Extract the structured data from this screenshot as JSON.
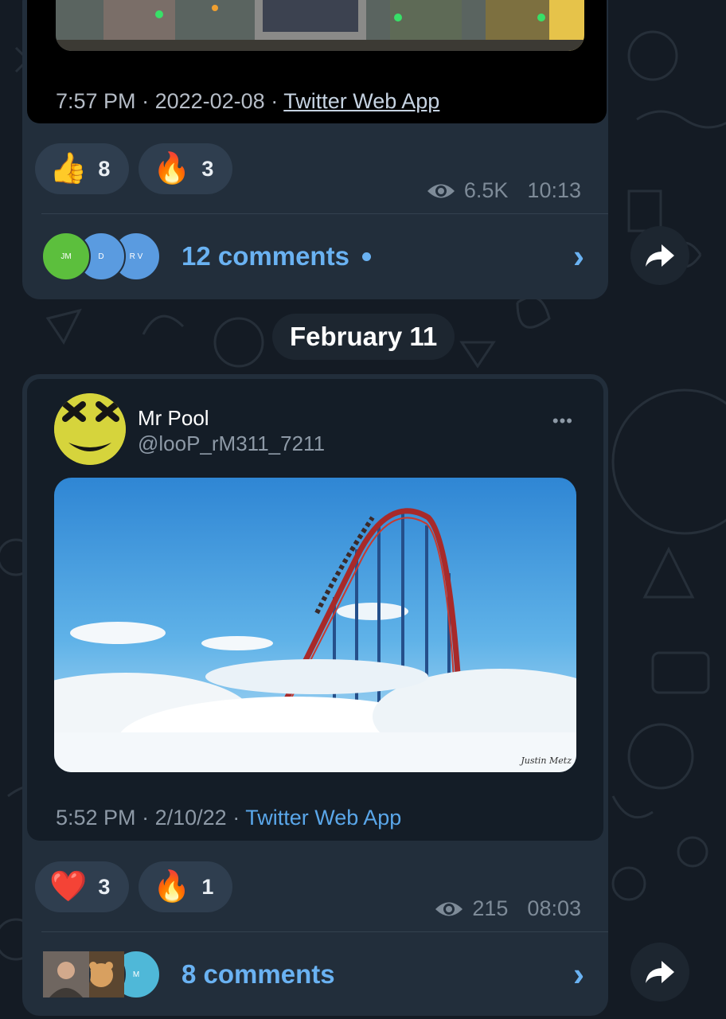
{
  "posts": [
    {
      "embed": {
        "time": "7:57 PM",
        "date": "2022-02-08",
        "source": "Twitter Web App"
      },
      "reactions": [
        {
          "emoji": "👍",
          "count": "8"
        },
        {
          "emoji": "🔥",
          "count": "3"
        }
      ],
      "views": "6.5K",
      "time": "10:13",
      "comment_avatars": [
        {
          "initials": "JM",
          "color": "#5cbf3d"
        },
        {
          "initials": "D",
          "color": "#5a9be0"
        },
        {
          "initials": "R V",
          "color": "#5a9be0"
        }
      ],
      "comments_label": "12 comments",
      "unread": true
    },
    {
      "tweet": {
        "author_name": "Mr Pool",
        "author_handle": "@looP_rM311_7211",
        "time": "5:52 PM",
        "date": "2/10/22",
        "source": "Twitter Web App",
        "image_watermark": "Justin Metz"
      },
      "reactions": [
        {
          "emoji": "❤️",
          "count": "3"
        },
        {
          "emoji": "🔥",
          "count": "1"
        }
      ],
      "views": "215",
      "time": "08:03",
      "comment_avatars": [
        {
          "initials": "",
          "color": "#8a7a70"
        },
        {
          "initials": "",
          "color": "#b57a3a"
        },
        {
          "initials": "M",
          "color": "#4fb8d8"
        }
      ],
      "comments_label": "8 comments",
      "unread": false
    }
  ],
  "date_separator": "February 11",
  "colors": {
    "background": "#141b24",
    "bubble": "#222e3b",
    "accent": "#6ab2f2",
    "reaction_pill": "#2f3e4f"
  }
}
